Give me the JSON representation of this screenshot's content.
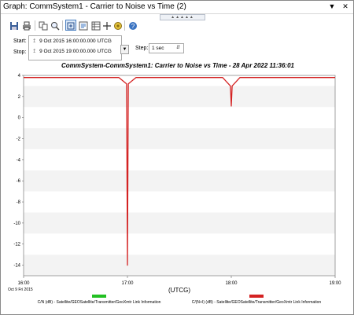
{
  "window": {
    "title": "Graph:  CommSystem1 - Carrier to Noise vs Time (2)"
  },
  "time_panel": {
    "start_label": "Start:",
    "start_value": "9 Oct 2015 16:00:00.000 UTCG",
    "stop_label": "Stop:",
    "stop_value": "9 Oct 2015 19:00:00.000 UTCG",
    "step_label": "Step:",
    "step_value": "1 sec"
  },
  "colors": {
    "series_cn": "#22c022",
    "series_cni": "#d42222",
    "accent": "#3b74c2"
  },
  "chart_data": {
    "type": "line",
    "title": "CommSystem-CommSystem1:  Carrier to Noise vs Time - 28 Apr 2022 11:36:01",
    "xlabel": "(UTCG)",
    "x_start_label": "Oct 9 Fri 2015",
    "xticks": [
      "16:00",
      "17:00",
      "18:00",
      "19:00"
    ],
    "xlim": [
      "16:00",
      "19:00"
    ],
    "ylim": [
      -15,
      4
    ],
    "yticks": [
      4,
      2,
      0,
      -2,
      -4,
      -6,
      -8,
      -10,
      -12,
      -14
    ],
    "ylabel": "",
    "grid": true,
    "legend_position": "bottom",
    "series": [
      {
        "name": "C/N (dB) - Satellite/GEOSatellite/Transmitter/GeoXmtr Link Information",
        "color": "#22c022",
        "x": [],
        "y": []
      },
      {
        "name": "C/(N+I) (dB) - Satellite/GEOSatellite/Transmitter/GeoXmtr Link Information",
        "color": "#d42222",
        "x": [
          "16:00",
          "16:30",
          "16:55",
          "16:59:30",
          "17:00",
          "17:00:30",
          "17:05",
          "17:30",
          "17:55",
          "17:59:30",
          "18:00",
          "18:00:30",
          "18:05",
          "18:30",
          "19:00"
        ],
        "y": [
          3.8,
          3.8,
          3.8,
          3.2,
          -14.0,
          3.2,
          3.8,
          3.8,
          3.8,
          3.0,
          1.1,
          3.0,
          3.8,
          3.8,
          3.8
        ]
      }
    ]
  }
}
